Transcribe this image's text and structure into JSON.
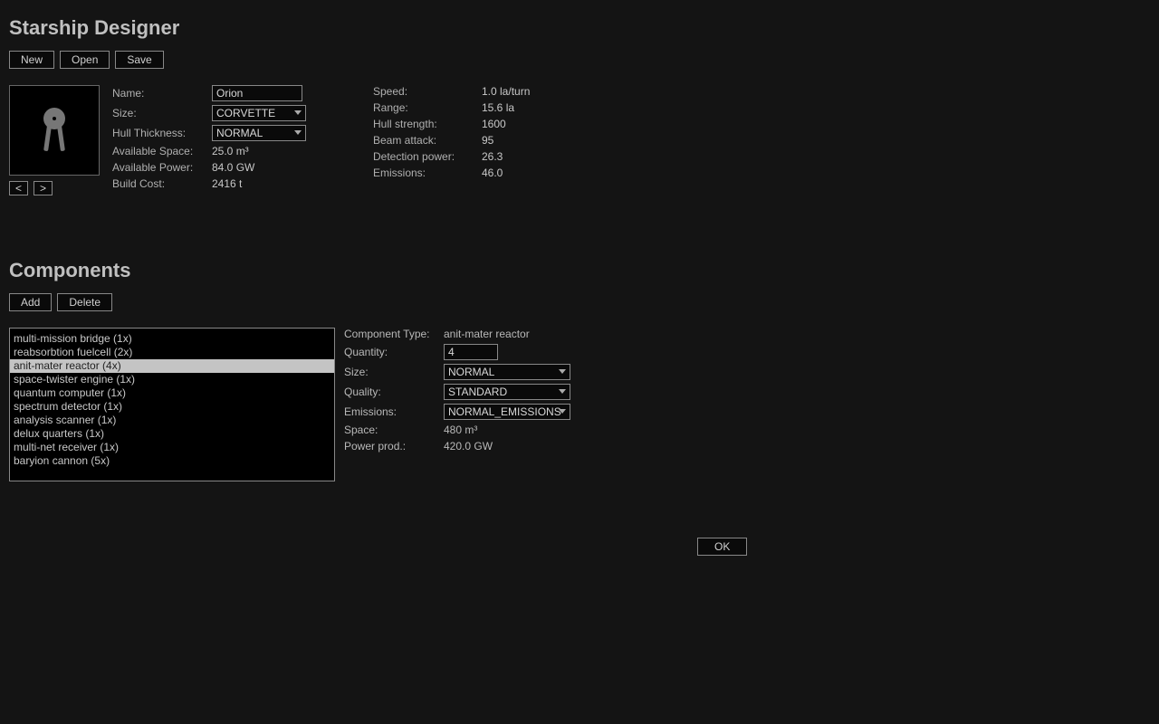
{
  "header": {
    "title": "Starship Designer",
    "buttons": {
      "new": "New",
      "open": "Open",
      "save": "Save"
    }
  },
  "preview_nav": {
    "prev": "<",
    "next": ">"
  },
  "shipForm": {
    "labels": {
      "name": "Name:",
      "size": "Size:",
      "hull_thickness": "Hull Thickness:",
      "avail_space": "Available Space:",
      "avail_power": "Available Power:",
      "build_cost": "Build Cost:"
    },
    "values": {
      "name": "Orion",
      "size": "CORVETTE",
      "hull_thickness": "NORMAL",
      "avail_space": "25.0 m³",
      "avail_power": "84.0 GW",
      "build_cost": "2416 t"
    }
  },
  "stats": {
    "labels": {
      "speed": "Speed:",
      "range": "Range:",
      "hull_strength": "Hull strength:",
      "beam_attack": "Beam attack:",
      "detection_power": "Detection power:",
      "emissions": "Emissions:"
    },
    "values": {
      "speed": "1.0 la/turn",
      "range": "15.6 la",
      "hull_strength": "1600",
      "beam_attack": "95",
      "detection_power": "26.3",
      "emissions": "46.0"
    }
  },
  "components": {
    "title": "Components",
    "buttons": {
      "add": "Add",
      "delete": "Delete"
    },
    "selected_index": 2,
    "list": [
      "multi-mission bridge (1x)",
      "reabsorbtion fuelcell (2x)",
      "anit-mater reactor (4x)",
      "space-twister engine (1x)",
      "quantum computer (1x)",
      "spectrum detector (1x)",
      "analysis scanner (1x)",
      "delux quarters (1x)",
      "multi-net receiver (1x)",
      "baryion cannon (5x)"
    ],
    "detail": {
      "labels": {
        "type": "Component Type:",
        "quantity": "Quantity:",
        "size": "Size:",
        "quality": "Quality:",
        "emissions": "Emissions:",
        "space": "Space:",
        "power_prod": "Power prod.:"
      },
      "values": {
        "type": "anit-mater reactor",
        "quantity": "4",
        "size": "NORMAL",
        "quality": "STANDARD",
        "emissions": "NORMAL_EMISSIONS",
        "space": "480 m³",
        "power_prod": "420.0 GW"
      }
    }
  },
  "footer": {
    "ok": "OK"
  }
}
